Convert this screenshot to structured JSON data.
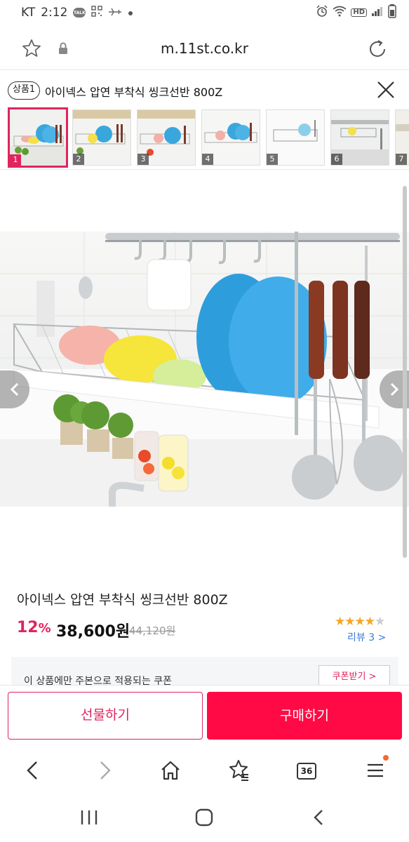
{
  "status_bar": {
    "carrier": "KT",
    "time": "2:12",
    "talk_label": "TALK",
    "hd_label": "HD"
  },
  "url_bar": {
    "url": "m.11st.co.kr"
  },
  "product_tab": {
    "badge": "상품1",
    "title": "아이넥스 압연 부착식 씽크선반 800Z"
  },
  "thumbnails": [
    {
      "num": "1",
      "active": true
    },
    {
      "num": "2",
      "active": false
    },
    {
      "num": "3",
      "active": false
    },
    {
      "num": "4",
      "active": false
    },
    {
      "num": "5",
      "active": false
    },
    {
      "num": "6",
      "active": false
    },
    {
      "num": "7",
      "active": false
    }
  ],
  "product": {
    "name": "아이넥스 압연 부착식 씽크선반 800Z",
    "discount_number": "12",
    "discount_unit": "%",
    "price": "38,600원",
    "original_price": "44,120원",
    "rating_stars": 4,
    "rating_max": 5,
    "review_label": "리뷰 3 >"
  },
  "coupon": {
    "text": "이 상품에만 주본으로 적용되는 쿠폰",
    "button": "쿠폰받기 >"
  },
  "actions": {
    "gift": "선물하기",
    "buy": "구매하기"
  },
  "browser_nav": {
    "tabs_count": "36"
  },
  "colors": {
    "accent": "#e0245e",
    "buy_button": "#ff0a45",
    "star": "#f5a623",
    "review_link": "#3b7bd6"
  }
}
